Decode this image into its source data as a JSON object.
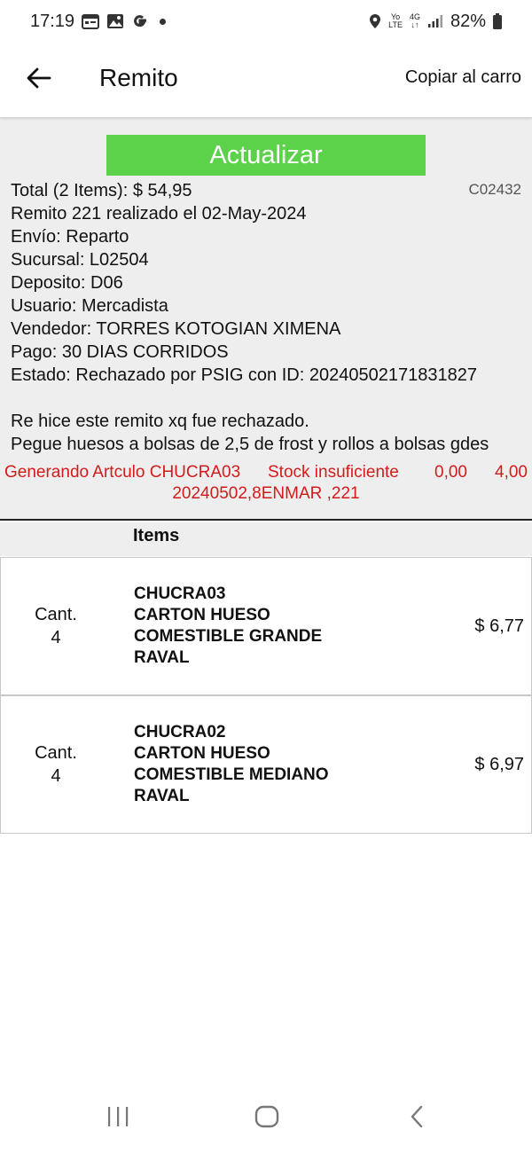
{
  "status_bar": {
    "time": "17:19",
    "battery": "82%",
    "network_top": "Yo",
    "network_bottom": "LTE",
    "gen": "4G",
    "icons": [
      "calendar-icon",
      "gallery-icon",
      "google-icon",
      "dot-icon",
      "location-icon",
      "signal-icon",
      "battery-icon"
    ]
  },
  "app_bar": {
    "title": "Remito",
    "copy_label": "Copiar al carro"
  },
  "info": {
    "update_label": "Actualizar",
    "code": "C02432",
    "lines": [
      "Total (2 Items): $ 54,95",
      "Remito 221 realizado el 02-May-2024",
      "Envío: Reparto",
      "Sucursal: L02504",
      "Deposito: D06",
      "Usuario: Mercadista",
      "Vendedor: TORRES KOTOGIAN XIMENA",
      "Pago: 30 DIAS CORRIDOS",
      "Estado: Rechazado por PSIG con ID: 20240502171831827"
    ],
    "notes": [
      "Re hice este remito xq fue rechazado.",
      "Pegue huesos a bolsas de 2,5 de frost y rollos a bolsas gdes"
    ],
    "error": {
      "article": "Generando Artculo CHUCRA03",
      "message": "Stock insuficiente",
      "value1": "0,00",
      "value2": "4,00",
      "line2": "20240502,8ENMAR ,221"
    }
  },
  "items_header": "Items",
  "items": [
    {
      "qty_label": "Cant.",
      "qty": "4",
      "desc": [
        "CHUCRA03",
        "CARTON HUESO",
        "COMESTIBLE GRANDE",
        "RAVAL"
      ],
      "price": "$ 6,77"
    },
    {
      "qty_label": "Cant.",
      "qty": "4",
      "desc": [
        "CHUCRA02",
        "CARTON HUESO",
        "COMESTIBLE MEDIANO",
        "RAVAL"
      ],
      "price": "$ 6,97"
    }
  ],
  "colors": {
    "accent_green": "#5cd14a",
    "error_red": "#d31b1b",
    "panel_gray": "#eeeeee"
  }
}
